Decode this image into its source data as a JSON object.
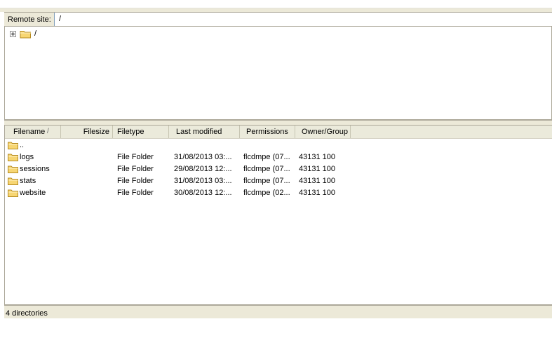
{
  "remote": {
    "label": "Remote site:",
    "path": "/"
  },
  "tree": {
    "root_label": "/"
  },
  "list": {
    "columns": [
      "Filename",
      "Filesize",
      "Filetype",
      "Last modified",
      "Permissions",
      "Owner/Group"
    ],
    "sort_indicator": "/",
    "rows": [
      {
        "name": "..",
        "size": "",
        "type": "",
        "modified": "",
        "perms": "",
        "owner": ""
      },
      {
        "name": "logs",
        "size": "",
        "type": "File Folder",
        "modified": "31/08/2013 03:...",
        "perms": "flcdmpe (07...",
        "owner": "43131 100"
      },
      {
        "name": "sessions",
        "size": "",
        "type": "File Folder",
        "modified": "29/08/2013 12:...",
        "perms": "flcdmpe (07...",
        "owner": "43131 100"
      },
      {
        "name": "stats",
        "size": "",
        "type": "File Folder",
        "modified": "31/08/2013 03:...",
        "perms": "flcdmpe (07...",
        "owner": "43131 100"
      },
      {
        "name": "website",
        "size": "",
        "type": "File Folder",
        "modified": "30/08/2013 12:...",
        "perms": "flcdmpe (02...",
        "owner": "43131 100"
      }
    ]
  },
  "status": {
    "text": "4 directories"
  },
  "colors": {
    "folder_fill": "#f7d673",
    "folder_stroke": "#b58a1e",
    "chrome": "#ece9d8"
  }
}
